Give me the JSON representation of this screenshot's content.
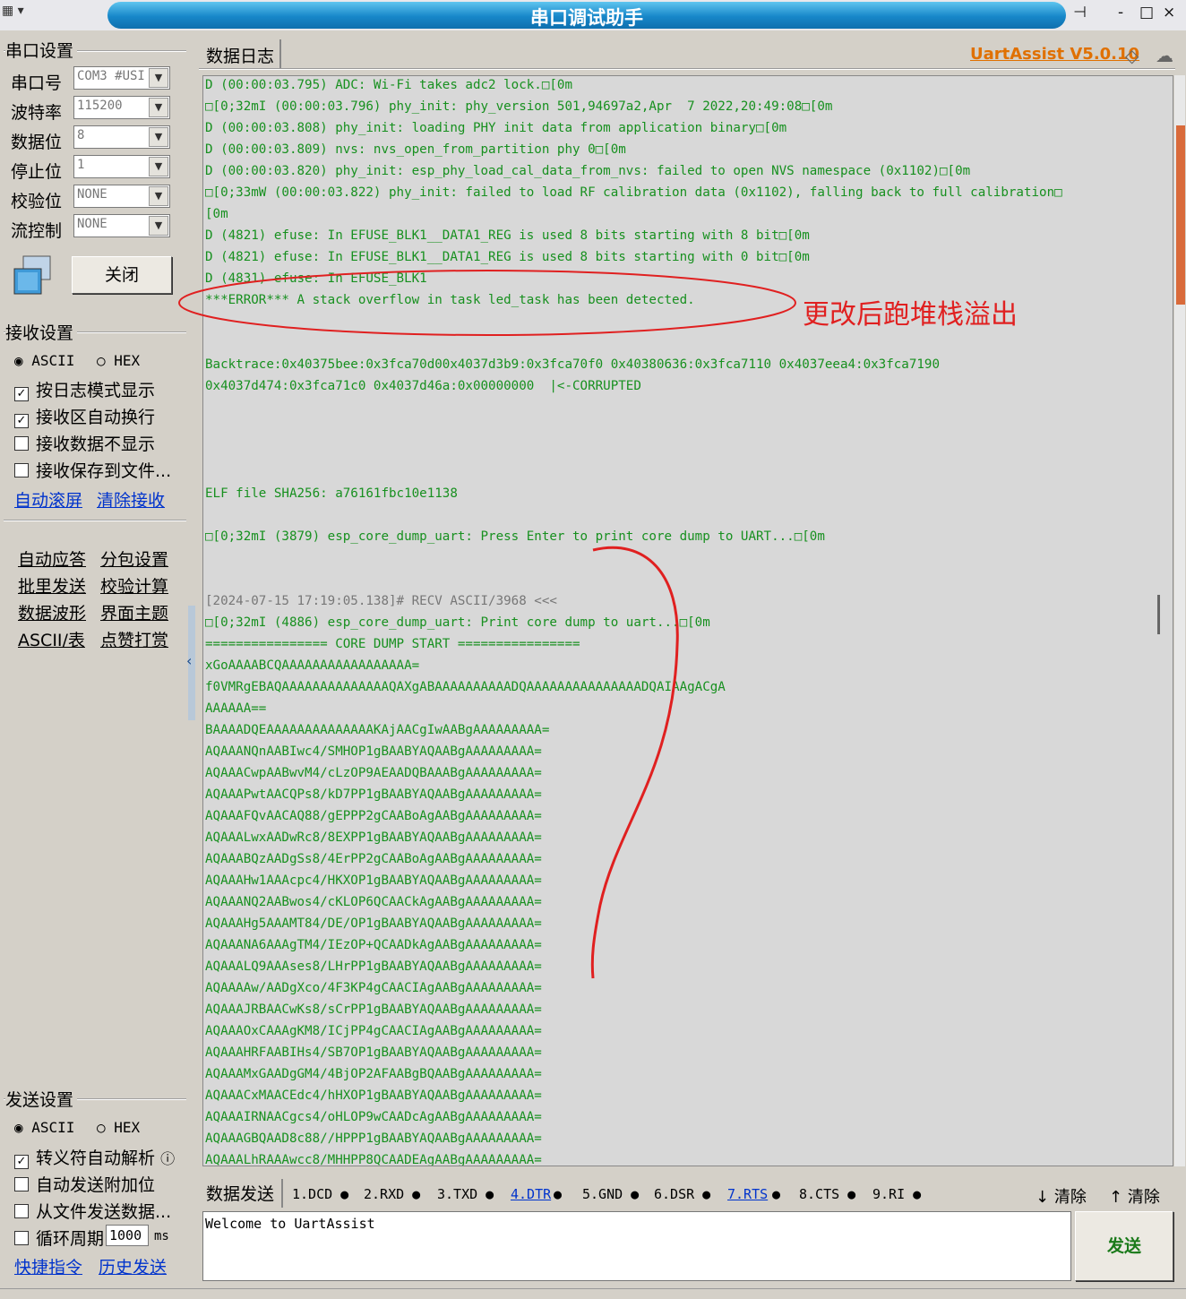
{
  "window": {
    "title": "串口调试助手",
    "version": "UartAssist V5.0.10",
    "controls": [
      "-",
      "□",
      "×"
    ]
  },
  "serial": {
    "group_title": "串口设置",
    "port": {
      "label": "串口号",
      "value": "COM3 #USI"
    },
    "baud": {
      "label": "波特率",
      "value": "115200"
    },
    "databits": {
      "label": "数据位",
      "value": "8"
    },
    "stopbits": {
      "label": "停止位",
      "value": "1"
    },
    "parity": {
      "label": "校验位",
      "value": "NONE"
    },
    "flow": {
      "label": "流控制",
      "value": "NONE"
    },
    "close_button": "关闭"
  },
  "receive": {
    "group_title": "接收设置",
    "ascii": "ASCII",
    "hex": "HEX",
    "opt_log_mode": "按日志模式显示",
    "opt_autowrap": "接收区自动换行",
    "opt_hide": "接收数据不显示",
    "opt_save": "接收保存到文件...",
    "link_autoscroll": "自动滚屏",
    "link_clear": "清除接收"
  },
  "tools": {
    "auto_reply": "自动应答",
    "packet": "分包设置",
    "batch_send": "批里发送",
    "checksum": "校验计算",
    "waveform": "数据波形",
    "theme": "界面主题",
    "ascii_table": "ASCII/表",
    "donate": "点赞打赏"
  },
  "send": {
    "group_title": "发送设置",
    "ascii": "ASCII",
    "hex": "HEX",
    "opt_escape": "转义符自动解析",
    "opt_append": "自动发送附加位",
    "opt_from_file": "从文件发送数据...",
    "opt_cycle": "循环周期",
    "cycle_value": "1000",
    "cycle_unit": "ms",
    "link_shortcut": "快捷指令",
    "link_history": "历史发送",
    "tab": "数据发送",
    "text": "Welcome to UartAssist",
    "send_button": "发送",
    "clear1": "清除",
    "clear2": "清除"
  },
  "pins": [
    "1.DCD",
    "2.RXD",
    "3.TXD",
    "4.DTR",
    "5.GND",
    "6.DSR",
    "7.RTS",
    "8.CTS",
    "9.RI"
  ],
  "log": {
    "tab": "数据日志",
    "annotation": "更改后跑堆栈溢出",
    "lines": [
      "D (00:00:03.795) ADC: Wi-Fi takes adc2 lock.□[0m",
      "□[0;32mI (00:00:03.796) phy_init: phy_version 501,94697a2,Apr  7 2022,20:49:08□[0m",
      "D (00:00:03.808) phy_init: loading PHY init data from application binary□[0m",
      "D (00:00:03.809) nvs: nvs_open_from_partition phy 0□[0m",
      "D (00:00:03.820) phy_init: esp_phy_load_cal_data_from_nvs: failed to open NVS namespace (0x1102)□[0m",
      "□[0;33mW (00:00:03.822) phy_init: failed to load RF calibration data (0x1102), falling back to full calibration□",
      "[0m",
      "D (4821) efuse: In EFUSE_BLK1__DATA1_REG is used 8 bits starting with 8 bit□[0m",
      "D (4821) efuse: In EFUSE_BLK1__DATA1_REG is used 8 bits starting with 0 bit□[0m",
      "D (4831) efuse: In EFUSE_BLK1",
      "***ERROR*** A stack overflow in task led_task has been detected.",
      "",
      "",
      "Backtrace:0x40375bee:0x3fca70d00x4037d3b9:0x3fca70f0 0x40380636:0x3fca7110 0x4037eea4:0x3fca7190",
      "0x4037d474:0x3fca71c0 0x4037d46a:0x00000000  |<-CORRUPTED",
      "",
      "",
      "",
      "",
      "ELF file SHA256: a76161fbc10e1138",
      "",
      "□[0;32mI (3879) esp_core_dump_uart: Press Enter to print core dump to UART...□[0m",
      "",
      "",
      "[2024-07-15 17:19:05.138]# RECV ASCII/3968 <<<",
      "□[0;32mI (4886) esp_core_dump_uart: Print core dump to uart...□[0m",
      "================ CORE DUMP START ================",
      "xGoAAAABCQAAAAAAAAAAAAAAAAA=",
      "f0VMRgEBAQAAAAAAAAAAAAAAQAXgABAAAAAAAAAADQAAAAAAAAAAAAAAADQAIAAgACgA",
      "AAAAAA==",
      "BAAAADQEAAAAAAAAAAAAAAKAjAACgIwAABgAAAAAAAAA=",
      "AQAAANQnAABIwc4/SMHOP1gBAABYAQAABgAAAAAAAAA=",
      "AQAAACwpAABwvM4/cLzOP9AEAADQBAAABgAAAAAAAAA=",
      "AQAAAPwtAACQPs8/kD7PP1gBAABYAQAABgAAAAAAAAA=",
      "AQAAAFQvAACAQ88/gEPPP2gCAABoAgAABgAAAAAAAAA=",
      "AQAAALwxAADwRc8/8EXPP1gBAABYAQAABgAAAAAAAAA=",
      "AQAAABQzAADgSs8/4ErPP2gCAABoAgAABgAAAAAAAAA=",
      "AQAAAHw1AAAcpc4/HKXOP1gBAABYAQAABgAAAAAAAAA=",
      "AQAAANQ2AABwos4/cKLOP6QCAACkAgAABgAAAAAAAAA=",
      "AQAAAHg5AAAMT84/DE/OP1gBAABYAQAABgAAAAAAAAA=",
      "AQAAANA6AAAgTM4/IEzOP+QCAADkAgAABgAAAAAAAAA=",
      "AQAAALQ9AAAses8/LHrPP1gBAABYAQAABgAAAAAAAAA=",
      "AQAAAAw/AADgXco/4F3KP4gCAACIAgAABgAAAAAAAAA=",
      "AQAAAJRBAACwKs8/sCrPP1gBAABYAQAABgAAAAAAAAA=",
      "AQAAAOxCAAAgKM8/ICjPP4gCAACIAgAABgAAAAAAAAA=",
      "AQAAAHRFAABIHs4/SB7OP1gBAABYAQAABgAAAAAAAAA=",
      "AQAAAMxGAADgGM4/4BjOP2AFAABgBQAABgAAAAAAAAA=",
      "AQAAACxMAACEdc4/hHXOP1gBAABYAQAABgAAAAAAAAA=",
      "AQAAAIRNAACgcs4/oHLOP9wCAADcAgAABgAAAAAAAAA=",
      "AQAAAGBQAAD8c88//HPPP1gBAABYAQAABgAAAAAAAAA=",
      "AQAAALhRAAAwcc8/MHHPP8QCAADEAgAABgAAAAAAAAA="
    ]
  }
}
